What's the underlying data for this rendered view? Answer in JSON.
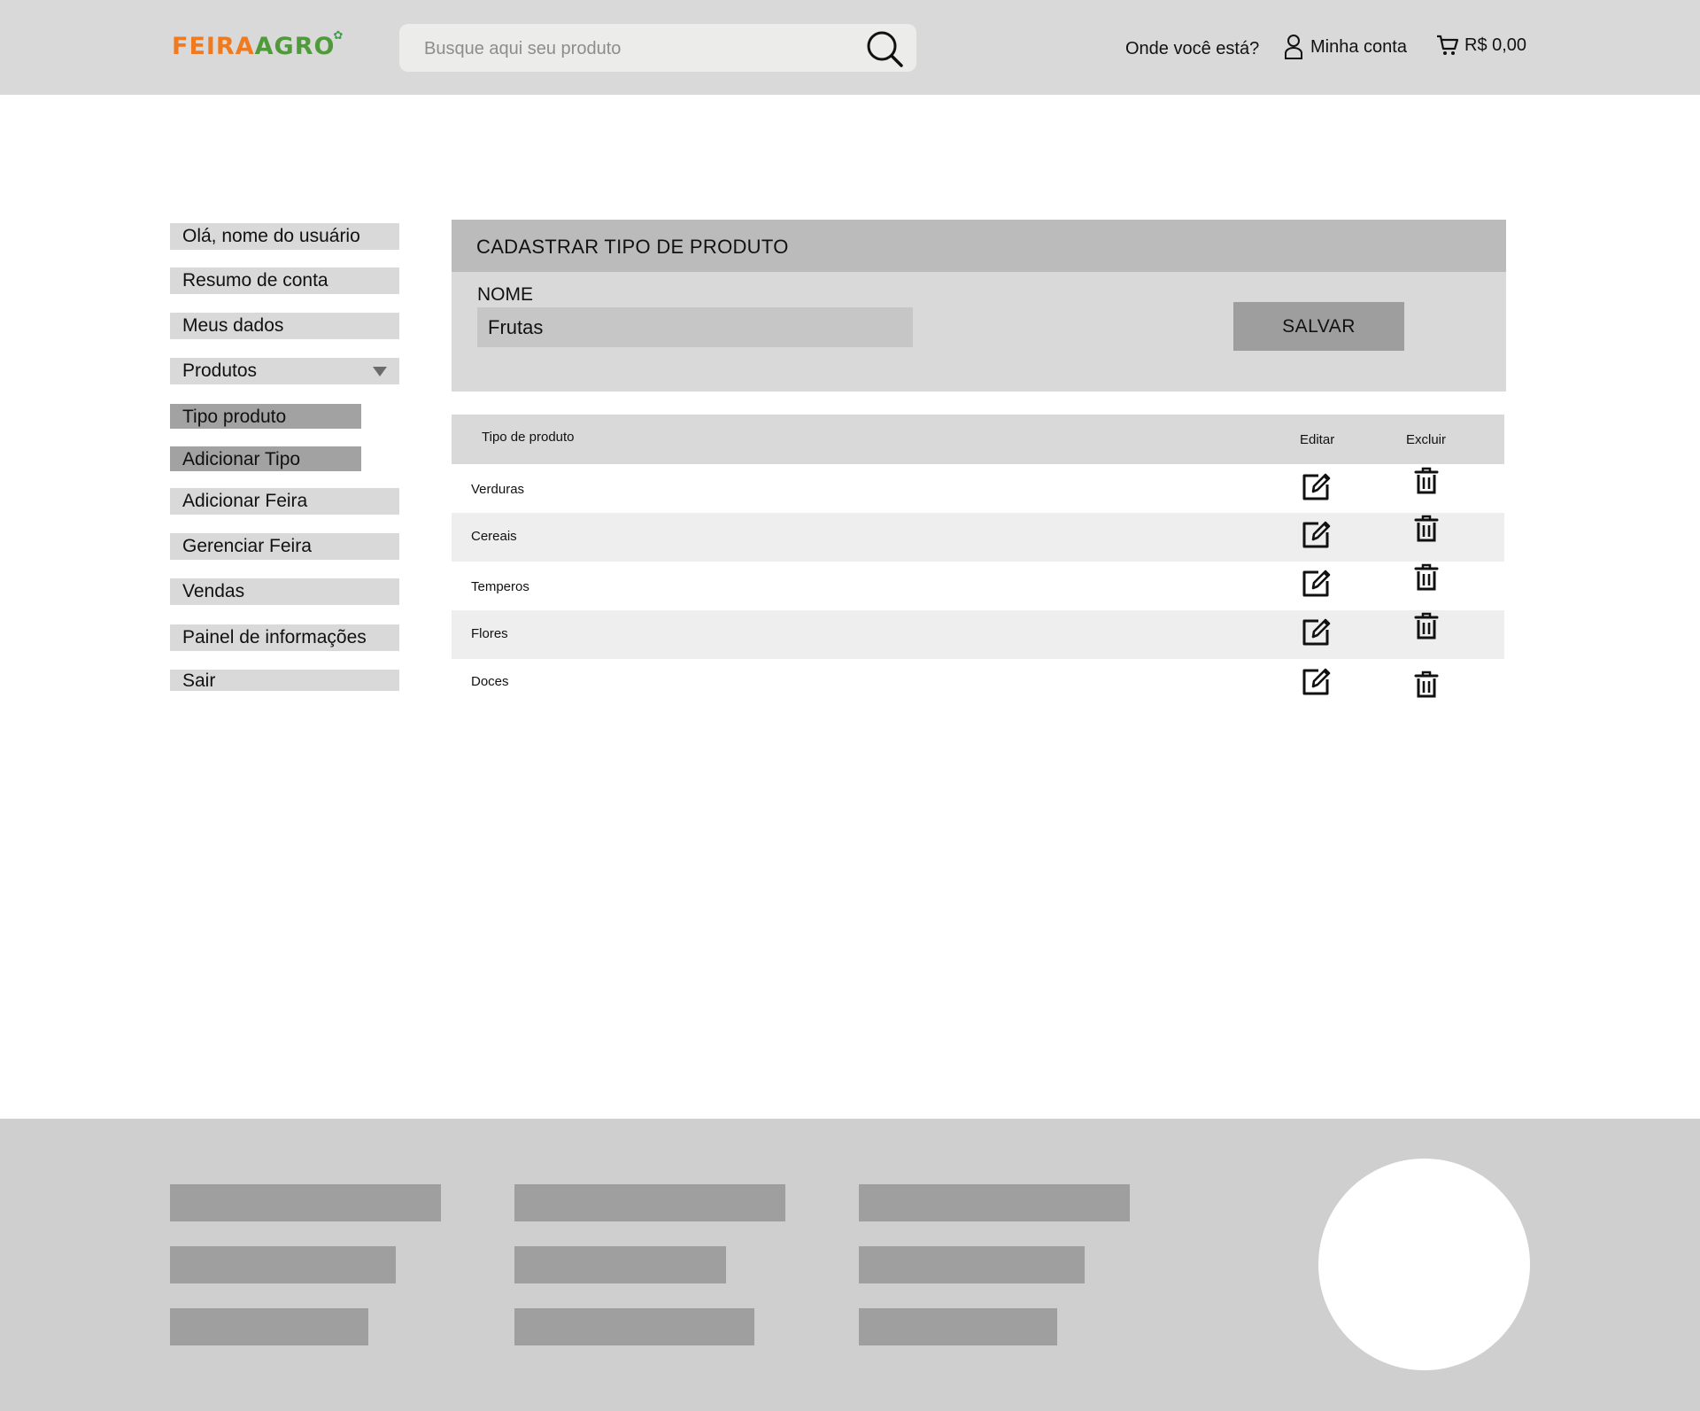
{
  "header": {
    "logo_part1": "FEIRA",
    "logo_part2": "GRO",
    "logo_a": "A",
    "search_placeholder": "Busque aqui seu produto",
    "location_label": "Onde você está?",
    "account_label": "Minha conta",
    "cart_total": "R$ 0,00",
    "brand_colors": {
      "orange": "#f07a1f",
      "green": "#4f9a3a"
    }
  },
  "sidebar": {
    "items": [
      {
        "label": "Olá, nome do usuário"
      },
      {
        "label": "Resumo de conta"
      },
      {
        "label": "Meus dados"
      },
      {
        "label": "Produtos"
      },
      {
        "label": "Tipo produto"
      },
      {
        "label": "Adicionar Tipo"
      },
      {
        "label": "Adicionar Feira"
      },
      {
        "label": "Gerenciar Feira"
      },
      {
        "label": "Vendas"
      },
      {
        "label": "Painel de informações"
      },
      {
        "label": "Sair"
      }
    ]
  },
  "form": {
    "title": "CADASTRAR TIPO DE PRODUTO",
    "name_label": "NOME",
    "name_value": "Frutas",
    "save_label": "SALVAR"
  },
  "table": {
    "headers": {
      "type": "Tipo de produto",
      "edit": "Editar",
      "delete": "Excluir"
    },
    "rows": [
      {
        "name": "Verduras"
      },
      {
        "name": "Cereais"
      },
      {
        "name": "Temperos"
      },
      {
        "name": "Flores"
      },
      {
        "name": "Doces"
      }
    ]
  }
}
